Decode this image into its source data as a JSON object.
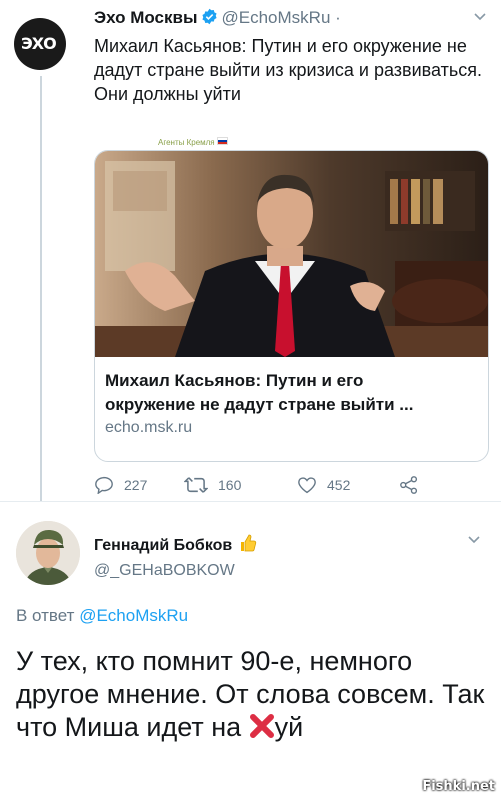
{
  "tweet": {
    "author": "Эхо Москвы",
    "handle": "@EchoMskRu ·",
    "avatar_text": "ЭХО",
    "text": "Михаил Касьянов: Путин и его окружение не дадут стране выйти из кризиса и развиваться. Они должны уйти",
    "stamp": "Агенты Кремля",
    "card": {
      "title_line1": "Михаил Касьянов: Путин и его",
      "title_line2": "окружение не дадут стране выйти ...",
      "url": "echo.msk.ru"
    },
    "actions": {
      "replies": "227",
      "retweets": "160",
      "likes": "452"
    }
  },
  "reply": {
    "author": "Геннадий Бобков",
    "handle": "@_GEHaBOBKOW",
    "reply_prefix": "В ответ",
    "reply_to": "@EchoMskRu",
    "text_before": "У тех, кто помнит 90-е, немного другое мнение. От слова совсем. Так что Миша идет на ",
    "text_after": "уй"
  },
  "watermark": "Fishki.net",
  "colors": {
    "accent": "#1da1f2",
    "muted": "#657786",
    "text": "#14171a"
  },
  "icons": [
    "verified-icon",
    "chevron-down-icon",
    "reply-icon",
    "retweet-icon",
    "like-icon",
    "share-icon",
    "thumbs-up-icon",
    "red-x-icon"
  ]
}
